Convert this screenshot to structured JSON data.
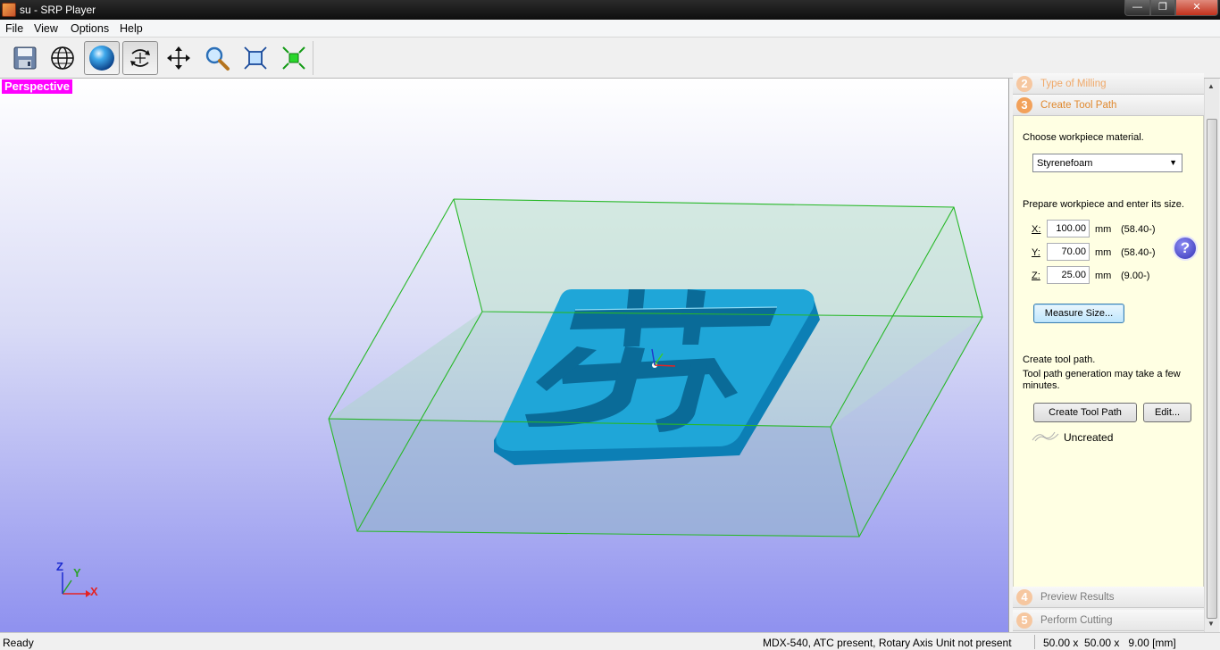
{
  "window": {
    "title": "su - SRP Player"
  },
  "menu": [
    "File",
    "View",
    "Options",
    "Help"
  ],
  "toolbar": {
    "items": [
      "save-icon",
      "globe-icon",
      "sphere-shading-icon",
      "rotate-icon",
      "pan-icon",
      "zoom-icon",
      "fit-view-icon",
      "zoom-extents-icon"
    ]
  },
  "viewport": {
    "view_label": "Perspective",
    "axes": {
      "x": "X",
      "y": "Y",
      "z": "Z"
    }
  },
  "panel": {
    "steps": [
      {
        "num": "2",
        "label": "Type of Milling"
      },
      {
        "num": "3",
        "label": "Create Tool Path"
      },
      {
        "num": "4",
        "label": "Preview Results"
      },
      {
        "num": "5",
        "label": "Perform Cutting"
      }
    ],
    "choose_material": "Choose workpiece material.",
    "material_value": "Styrenefoam",
    "prepare_text": "Prepare workpiece and enter its size.",
    "size": [
      {
        "axis": "X:",
        "value": "100.00",
        "unit": "mm",
        "range": "(58.40-)"
      },
      {
        "axis": "Y:",
        "value": "70.00",
        "unit": "mm",
        "range": "(58.40-)"
      },
      {
        "axis": "Z:",
        "value": "25.00",
        "unit": "mm",
        "range": "(9.00-)"
      }
    ],
    "measure_button": "Measure Size...",
    "create_text_1": "Create tool path.",
    "create_text_2": "Tool path generation may take a few",
    "create_text_3": "minutes.",
    "create_button": "Create Tool Path",
    "edit_button": "Edit...",
    "toolpath_status": "Uncreated",
    "help_label": "?"
  },
  "status": {
    "left": "Ready",
    "machine": "MDX-540, ATC present, Rotary Axis Unit not present",
    "dims": "50.00 x  50.00 x   9.00 [mm]"
  },
  "colors": {
    "view_label_bg": "#ff00ff",
    "step_accent": "#f2a15a",
    "panel_body": "#ffffe3",
    "model": "#1fa6d8",
    "box_edges": "#2fb82f"
  }
}
